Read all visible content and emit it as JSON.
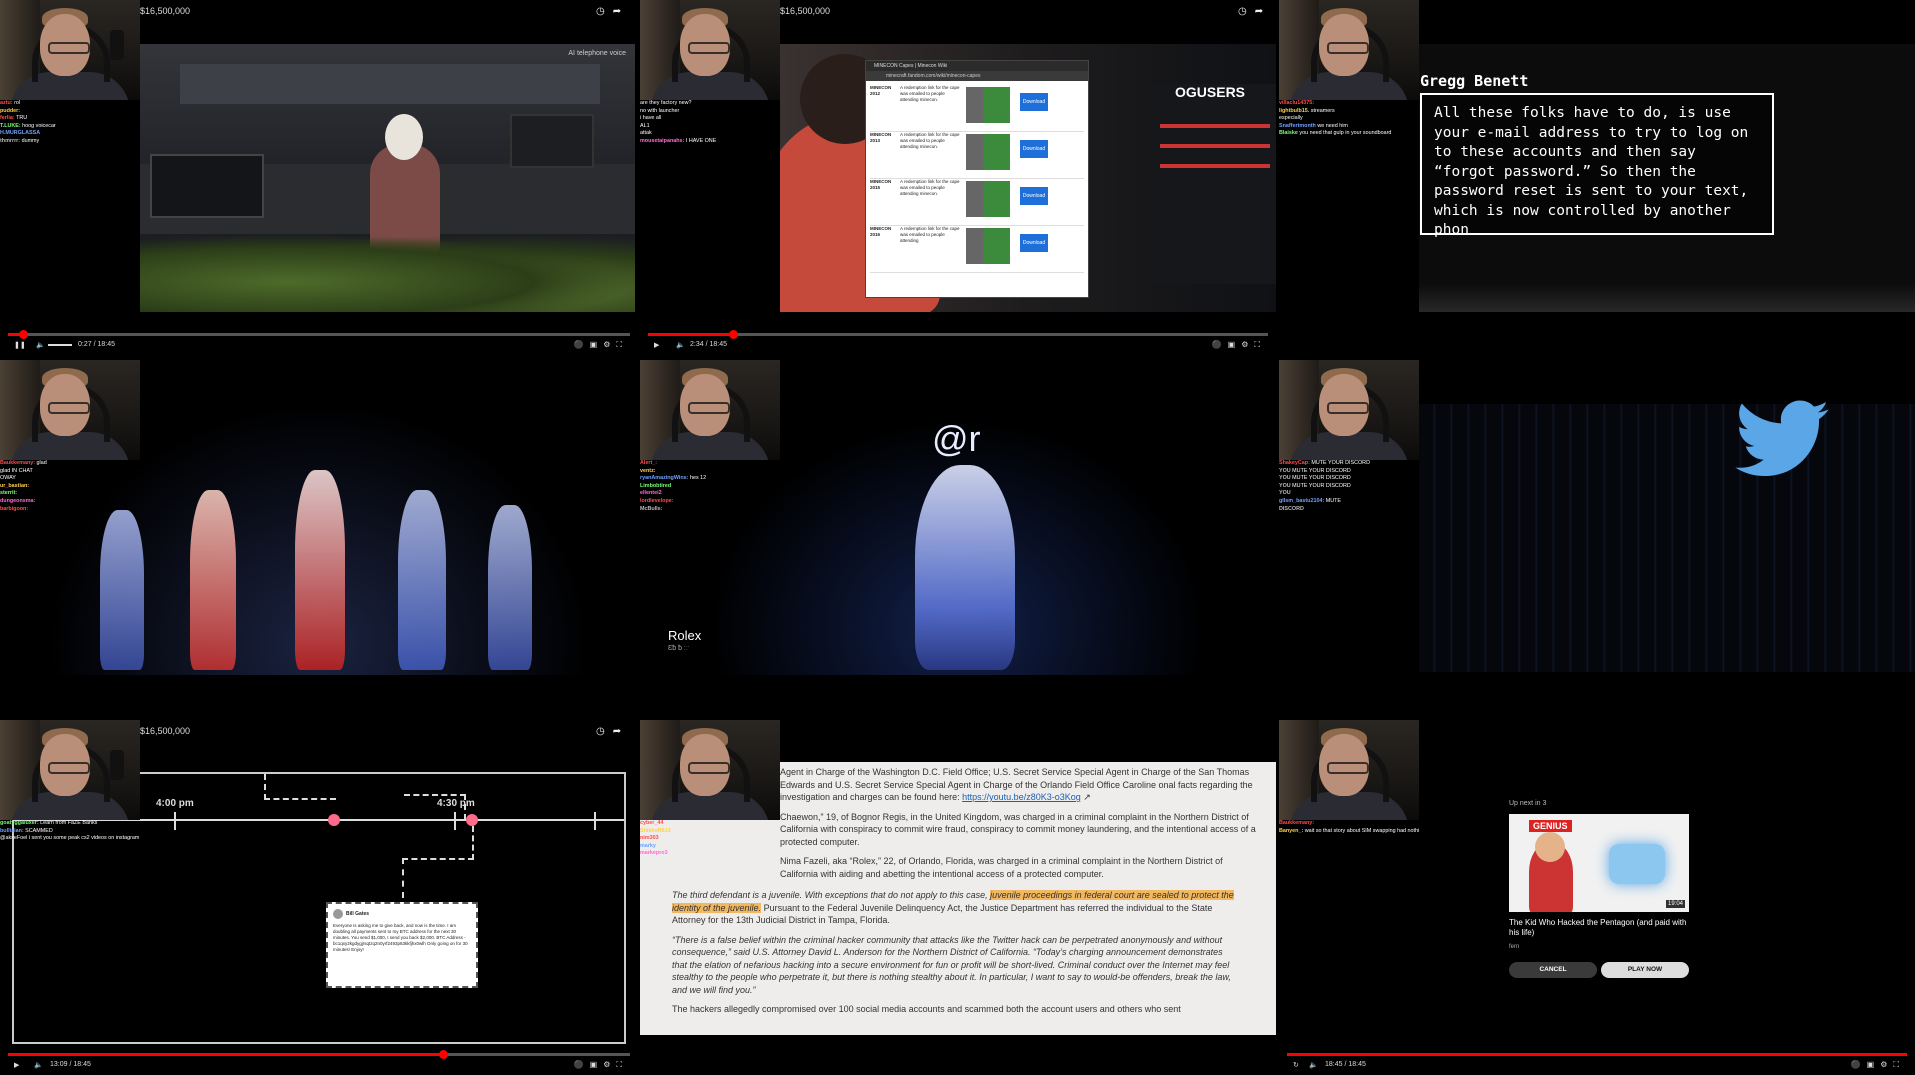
{
  "tiles": {
    "t1": {
      "top_text": "$16,500,000",
      "overlay_text": "AI telephone voice",
      "time": "0:27 / 18:45",
      "progress": 0.024,
      "chat": [
        {
          "user": "aztu:",
          "msg": "rol",
          "color": "#ff4d4d"
        },
        {
          "user": "pudder:",
          "msg": "",
          "color": "#ffd04d"
        },
        {
          "user": "",
          "msg": "",
          "color": "#4dd0ff"
        },
        {
          "user": "ferlia:",
          "msg": "TRU",
          "color": "#ff4d4d"
        },
        {
          "user": "T.LUKE:",
          "msg": "hoog voicecar",
          "color": "#7cff7c"
        },
        {
          "user": "H.MURGLASSA",
          "msg": "",
          "color": "#6ea2ff"
        },
        {
          "user": "thmrrrr:",
          "msg": "dummy",
          "color": "#bbbbbb"
        }
      ]
    },
    "t2": {
      "top_text": "$16,500,000",
      "time": "2:34 / 18:45",
      "progress": 0.137,
      "browser_title": "MINECON Capes | Minecon Wiki",
      "address": "minecraft.fandom.com/wiki/minecon-capes",
      "site_logo": "OGUSERS",
      "rows": [
        {
          "year": "MINECON 2012",
          "desc": "A redemption link for the cape was emailed to people attending minecon.",
          "btn": "Download"
        },
        {
          "year": "MINECON 2013",
          "desc": "A redemption link for the cape was emailed to people attending minecon.",
          "btn": "Download"
        },
        {
          "year": "MINECON 2015",
          "desc": "A redemption link for the cape was emailed to people attending minecon.",
          "btn": "Download"
        },
        {
          "year": "MINECON 2016",
          "desc": "A redemption link for the cape was emailed to people attending",
          "btn": "Download"
        }
      ],
      "chat": [
        {
          "user": "",
          "msg": "are they factory new?",
          "color": "#ff4d4d"
        },
        {
          "user": "",
          "msg": "no with launcher",
          "color": "#7cff7c"
        },
        {
          "user": "",
          "msg": "i have all",
          "color": "#bbbbbb"
        },
        {
          "user": "",
          "msg": "AL1",
          "color": "#ffd04d"
        },
        {
          "user": "",
          "msg": "attak",
          "color": "#6ea2ff"
        },
        {
          "user": "mousetaipanahs:",
          "msg": "I HAVE ONE",
          "color": "#ff6ad5"
        }
      ]
    },
    "t3": {
      "speaker": "Gregg Benett",
      "caption": "All these folks have to do, is use your e-mail address to try to log on to these accounts and then say “forgot password.” So then the password reset is sent to your text, which is now controlled by another phon",
      "chat": [
        {
          "user": "villaclu14375:",
          "msg": "",
          "color": "#ff4d4d"
        },
        {
          "user": "lightbulb15.",
          "msg": "streamers",
          "color": "#ffd04d"
        },
        {
          "user": "",
          "msg": "especially",
          "color": "#bbbbbb"
        },
        {
          "user": "Snaffertmonth",
          "msg": "we need him",
          "color": "#6ea2ff"
        },
        {
          "user": "Blaiske",
          "msg": "you need that gulp in your soundboard",
          "color": "#7cff7c"
        }
      ]
    },
    "t4": {
      "chat": [
        {
          "user": "Baukkemany:",
          "msg": "glad",
          "color": "#ff4d4d"
        },
        {
          "user": "",
          "msg": "glad IN CHAT",
          "color": "#6ea2ff"
        },
        {
          "user": "",
          "msg": "OWAY",
          "color": "#bbbbbb"
        },
        {
          "user": "ur_bastian:",
          "msg": "",
          "color": "#ffd04d"
        },
        {
          "user": "sterrit:",
          "msg": "",
          "color": "#7cff7c"
        },
        {
          "user": "dungeonsma:",
          "msg": "",
          "color": "#ff6ad5"
        },
        {
          "user": "barbigoon:",
          "msg": "",
          "color": "#ff4d4d"
        }
      ]
    },
    "t5": {
      "handle": "@r",
      "name_tag": "Rolex",
      "name_tag_sub": "Ɛƀ ƀ ːːˑ",
      "chat": [
        {
          "user": "Alert_:",
          "msg": "",
          "color": "#ff4d4d"
        },
        {
          "user": "ventz:",
          "msg": "",
          "color": "#ffd04d"
        },
        {
          "user": "ryanAmazingWins:",
          "msg": "hes 12",
          "color": "#6ea2ff"
        },
        {
          "user": "Limbobtired",
          "msg": "",
          "color": "#7cff7c"
        },
        {
          "user": "ellentei2",
          "msg": "",
          "color": "#ff6ad5"
        },
        {
          "user": "lordlevelope:",
          "msg": "",
          "color": "#ff4d4d"
        },
        {
          "user": "McBulls:",
          "msg": "",
          "color": "#bbbbbb"
        }
      ]
    },
    "t6": {
      "chat": [
        {
          "user": "ShakeyCap:",
          "msg": "MUTE YOUR DISCORD",
          "color": "#ff4d4d"
        },
        {
          "user": "YOU",
          "msg": "MUTE YOUR DISCORD",
          "color": "#bbbbbb"
        },
        {
          "user": "YOU",
          "msg": "MUTE YOUR DISCORD",
          "color": "#bbbbbb"
        },
        {
          "user": "YOU",
          "msg": "MUTE YOUR DISCORD",
          "color": "#bbbbbb"
        },
        {
          "user": "YOU",
          "msg": "",
          "color": "#bbbbbb"
        },
        {
          "user": "gllsm_bastu2104:",
          "msg": "MUTE",
          "color": "#6ea2ff"
        },
        {
          "user": "DISCORD",
          "msg": "",
          "color": "#bbbbbb"
        }
      ]
    },
    "t7": {
      "top_text": "$16,500,000",
      "time": "13:09 / 18:45",
      "progress": 0.7,
      "time_a": "4:00 pm",
      "time_b": "4:30 pm",
      "tweet_name": "Bill Gates",
      "tweet_text": "Everyone is asking me to give back, and now is the time. I am doubling all payments sent to my BTC address for the next 30 minutes. You send $1,000, I send you back $2,000. BTC Address - bc1qxy2kgdygjrsqtzq2n0yrf2493p83kkfjhx0wlh Only going on for 30 minutes! Enjoy!",
      "chat": [
        {
          "user": "goatyggaluxer:",
          "msg": "Learn from FaZE Banks",
          "color": "#7cff7c"
        },
        {
          "user": "",
          "msg": "",
          "color": "#ff4d4d"
        },
        {
          "user": "bullisian:",
          "msg": "SCAMMED",
          "color": "#6ea2ff"
        },
        {
          "user": "",
          "msg": "@akseFoel i sent you some peak cs2 videos on instagram bro check them",
          "color": "#ff6ad5"
        }
      ]
    },
    "t8": {
      "p1": "Agent in Charge of the Washington D.C. Field Office; U.S. Secret Service Special Agent in Charge of the San Thomas Edwards and U.S. Secret Service Special Agent in Charge of the Orlando Field Office Caroline onal facts regarding the investigation and charges can be found here:",
      "link": "https://youtu.be/z80K3-o3Kog",
      "p2": "Chaewon,” 19, of Bognor Regis, in the United Kingdom, was charged in a criminal complaint in the Northern District of California with conspiracy to commit wire fraud, conspiracy to commit money laundering, and the intentional access of a protected computer.",
      "p3": "Nima Fazeli, aka “Rolex,” 22, of Orlando, Florida, was charged in a criminal complaint in the Northern District of California with aiding and abetting the intentional access of a protected computer.",
      "p4a": "The third defendant is a juvenile.  With exceptions that do not apply to this case,",
      "p4h": "juvenile proceedings in federal court are sealed to protect the identity of the juvenile.",
      "p4b": "Pursuant to the Federal Juvenile Delinquency Act, the Justice Department has referred the individual to the State Attorney for the 13th Judicial District in Tampa, Florida.",
      "p5": "“There is a false belief within the criminal hacker community that attacks like the Twitter hack can be perpetrated anonymously and without consequence,” said U.S. Attorney David L. Anderson for the Northern District of California. “Today’s charging announcement demonstrates that the elation of nefarious hacking into a secure environment for fun or profit will be short-lived. Criminal conduct over the Internet may feel stealthy to the people who perpetrate it, but there is nothing stealthy about it. In particular, I want to say to would-be offenders, break the law, and we will find you.”",
      "p6": "The hackers allegedly compromised over 100 social media accounts and scammed both the account users and others who sent",
      "chat": [
        {
          "user": "cyber_44",
          "msg": "",
          "color": "#ff4d4d"
        },
        {
          "user": "ShikkoR613",
          "msg": "",
          "color": "#ffd04d"
        },
        {
          "user": "",
          "msg": "",
          "color": "#7cff7c"
        },
        {
          "user": "nim303",
          "msg": "",
          "color": "#ff4d4d"
        },
        {
          "user": "marky",
          "msg": "",
          "color": "#6ea2ff"
        },
        {
          "user": "markepro3",
          "msg": "",
          "color": "#ff6ad5"
        }
      ]
    },
    "t9": {
      "up_next": "Up next in 3",
      "brand": "GENIUS",
      "duration": "19:04",
      "video_title": "The Kid Who Hacked the Pentagon (and paid with his life)",
      "channel": "fern",
      "cancel": "CANCEL",
      "play": "PLAY NOW",
      "time": "18:45 / 18:45",
      "progress": 1.0,
      "chat": [
        {
          "user": "Baukkemany:",
          "msg": "",
          "color": "#ff4d4d"
        },
        {
          "user": "",
          "msg": "",
          "color": "#6ea2ff"
        },
        {
          "user": "",
          "msg": "",
          "color": "#bbbbbb"
        },
        {
          "user": "Banyen_:",
          "msg": "wait so that story about SIM swapping had nothing to do with any of this??",
          "color": "#ffd04d"
        },
        {
          "user": "",
          "msg": "",
          "color": "#ff6ad5"
        }
      ]
    }
  }
}
